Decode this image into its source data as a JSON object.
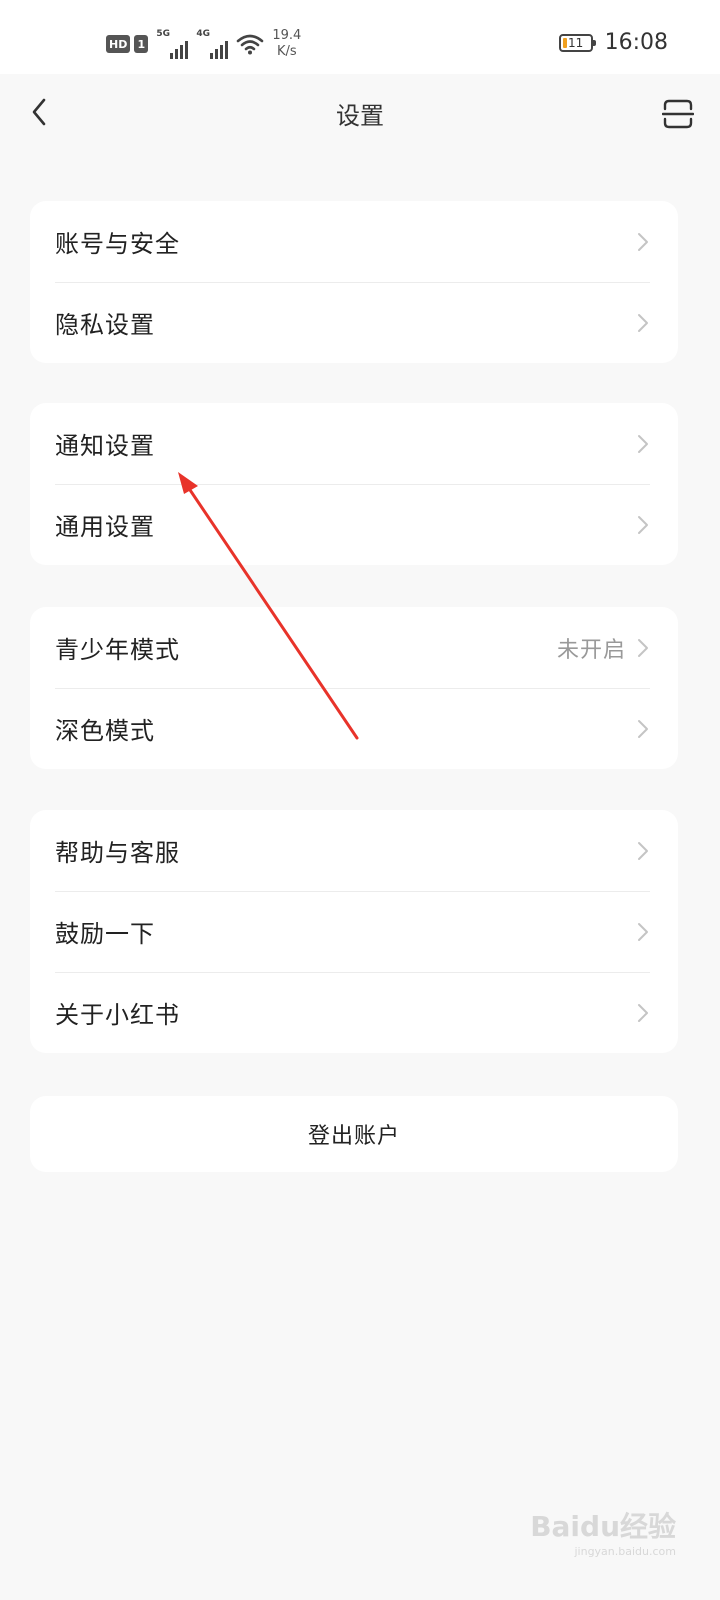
{
  "status_bar": {
    "badge_hd": "HD",
    "badge_sim": "1",
    "net1_type": "5G",
    "net2_type": "4G",
    "speed_value": "19.4",
    "speed_unit": "K/s",
    "battery_level": "11",
    "time": "16:08"
  },
  "nav": {
    "back_icon": "chevron-left-icon",
    "title": "设置",
    "scan_icon": "scan-icon"
  },
  "groups": {
    "account": {
      "items": [
        {
          "label": "账号与安全"
        },
        {
          "label": "隐私设置"
        }
      ]
    },
    "settings": {
      "items": [
        {
          "label": "通知设置"
        },
        {
          "label": "通用设置"
        }
      ]
    },
    "modes": {
      "items": [
        {
          "label": "青少年模式",
          "value": "未开启"
        },
        {
          "label": "深色模式"
        }
      ]
    },
    "about": {
      "items": [
        {
          "label": "帮助与客服"
        },
        {
          "label": "鼓励一下"
        },
        {
          "label": "关于小红书"
        }
      ]
    }
  },
  "logout_label": "登出账户",
  "annotation_color": "#e8332a",
  "watermark": {
    "logo": "Baidu经验",
    "sub": "jingyan.baidu.com"
  }
}
